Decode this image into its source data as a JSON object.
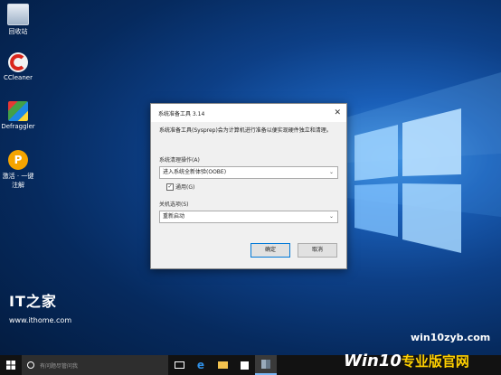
{
  "desktop": {
    "icons": [
      {
        "label": "回收站",
        "icon": "recycle-bin-icon"
      },
      {
        "label": "CCleaner",
        "icon": "ccleaner-icon"
      },
      {
        "label": "Defraggler",
        "icon": "defraggler-icon"
      },
      {
        "label": "激活 · 一键注解",
        "icon": "activator-icon"
      }
    ],
    "watermark": {
      "brand": "IT之家",
      "url": "www.ithome.com"
    },
    "site_watermark": "win10zyb.com",
    "site_brand": {
      "win": "Win10",
      "rest": "专业版官网"
    }
  },
  "dialog": {
    "title": "系统准备工具 3.14",
    "description": "系统准备工具(Sysprep)会为计算机进行准备以便实现硬件独立和清理。",
    "cleanup_group": {
      "label": "系统清理操作(A)",
      "selected": "进入系统全新体验(OOBE)",
      "generalize_label": "通用(G)",
      "generalize_checked": true
    },
    "shutdown_group": {
      "label": "关机选项(S)",
      "selected": "重新启动"
    },
    "ok_label": "确定",
    "cancel_label": "取消"
  },
  "taskbar": {
    "search_placeholder": "有问题尽管问我"
  },
  "colors": {
    "accent": "#0078d7",
    "taskbar": "#121212",
    "desktop_blue": "#1a5fb8"
  }
}
